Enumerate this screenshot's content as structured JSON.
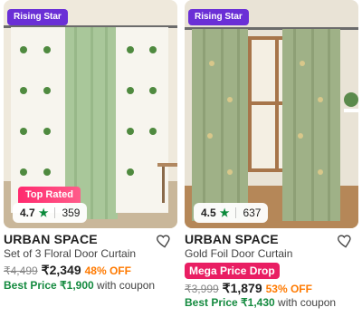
{
  "products": [
    {
      "badge": "Rising Star",
      "top_rated": "Top Rated",
      "rating": "4.7",
      "reviews": "359",
      "brand": "URBAN SPACE",
      "name": "Set of 3 Floral Door Curtain",
      "mrp": "₹4,499",
      "price": "₹2,349",
      "discount": "48% OFF",
      "best_price_label": "Best Price ₹1,900",
      "best_price_suffix": "with coupon"
    },
    {
      "badge": "Rising Star",
      "rating": "4.5",
      "reviews": "637",
      "brand": "URBAN SPACE",
      "name": "Gold Foil Door Curtain",
      "promo": "Mega Price Drop",
      "mrp": "₹3,999",
      "price": "₹1,879",
      "discount": "53% OFF",
      "best_price_label": "Best Price ₹1,430",
      "best_price_suffix": "with coupon"
    }
  ],
  "colors": {
    "badge_purple": "#6a2fd6",
    "rating_star_green": "#0a8a3a",
    "best_price_green": "#148a3f",
    "discount_orange": "#ff7a00",
    "mega_pink": "#e91e63"
  }
}
